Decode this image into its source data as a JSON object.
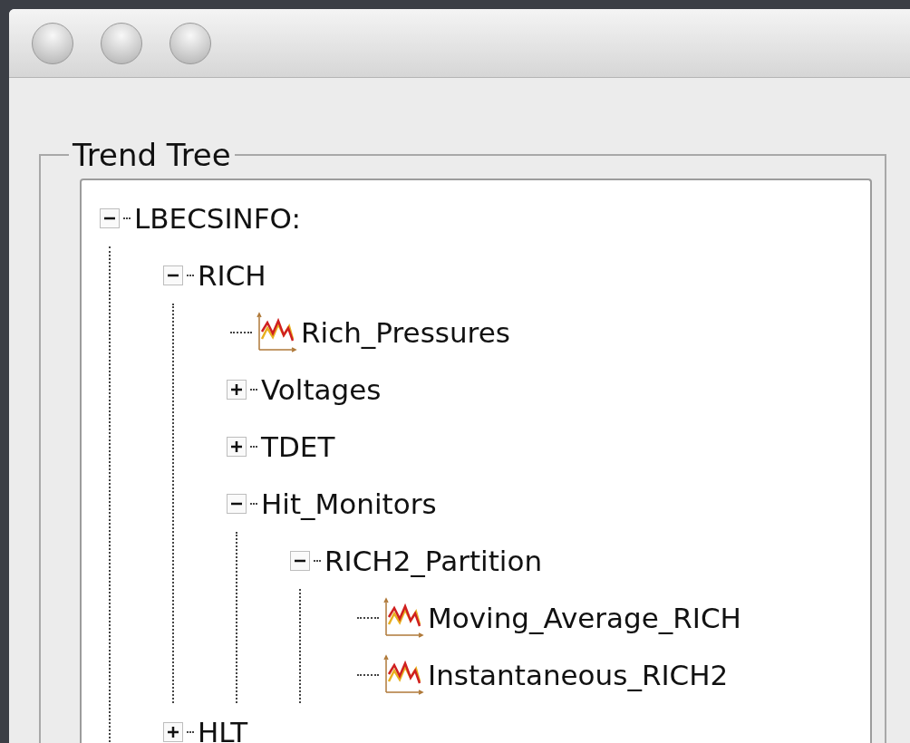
{
  "group": {
    "title": "Trend Tree"
  },
  "tree": {
    "items": [
      {
        "label": "LBECSINFO:",
        "kind": "folder",
        "expanded": true,
        "children": [
          {
            "label": "RICH",
            "kind": "folder",
            "expanded": true,
            "children": [
              {
                "label": "Rich_Pressures",
                "kind": "trend"
              },
              {
                "label": "Voltages",
                "kind": "folder",
                "expanded": false
              },
              {
                "label": "TDET",
                "kind": "folder",
                "expanded": false
              },
              {
                "label": "Hit_Monitors",
                "kind": "folder",
                "expanded": true,
                "children": [
                  {
                    "label": "RICH2_Partition",
                    "kind": "folder",
                    "expanded": true,
                    "children": [
                      {
                        "label": "Moving_Average_RICH",
                        "kind": "trend"
                      },
                      {
                        "label": "Instantaneous_RICH2",
                        "kind": "trend"
                      }
                    ]
                  }
                ]
              }
            ]
          },
          {
            "label": "HLT",
            "kind": "folder",
            "expanded": false
          }
        ]
      }
    ]
  }
}
